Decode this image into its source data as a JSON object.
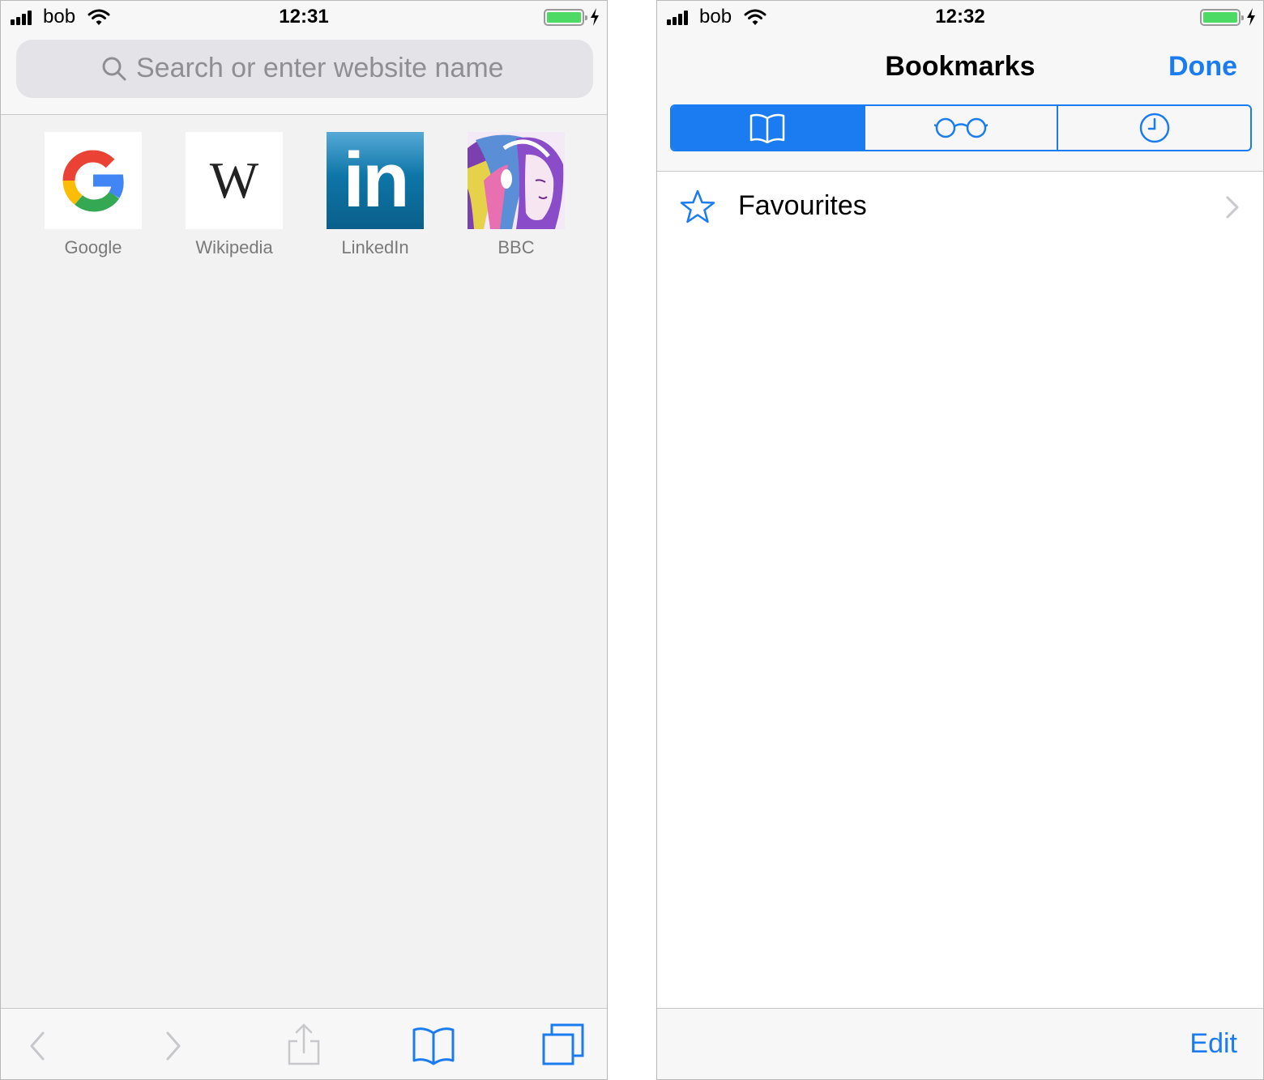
{
  "left_screen": {
    "status": {
      "carrier": "bob",
      "time": "12:31"
    },
    "search": {
      "placeholder": "Search or enter website name"
    },
    "favourites": [
      {
        "label": "Google",
        "icon": "google-logo-icon"
      },
      {
        "label": "Wikipedia",
        "icon": "wikipedia-logo-icon",
        "glyph": "W"
      },
      {
        "label": "LinkedIn",
        "icon": "linkedin-logo-icon",
        "glyph": "in"
      },
      {
        "label": "BBC",
        "icon": "bbc-artwork-icon"
      }
    ],
    "toolbar": [
      "back-icon",
      "forward-icon",
      "share-icon",
      "bookmarks-icon",
      "tabs-icon"
    ]
  },
  "right_screen": {
    "status": {
      "carrier": "bob",
      "time": "12:32"
    },
    "nav": {
      "title": "Bookmarks",
      "done_label": "Done"
    },
    "segments": [
      {
        "icon": "book-icon",
        "selected": true
      },
      {
        "icon": "glasses-icon",
        "selected": false
      },
      {
        "icon": "clock-icon",
        "selected": false
      }
    ],
    "list": [
      {
        "label": "Favourites",
        "icon": "star-icon"
      }
    ],
    "toolbar": {
      "edit_label": "Edit"
    }
  },
  "colors": {
    "accent": "#1a7cf0",
    "battery": "#4cd964",
    "linkedin": "#0e76a8",
    "background": "#f2f2f2"
  }
}
